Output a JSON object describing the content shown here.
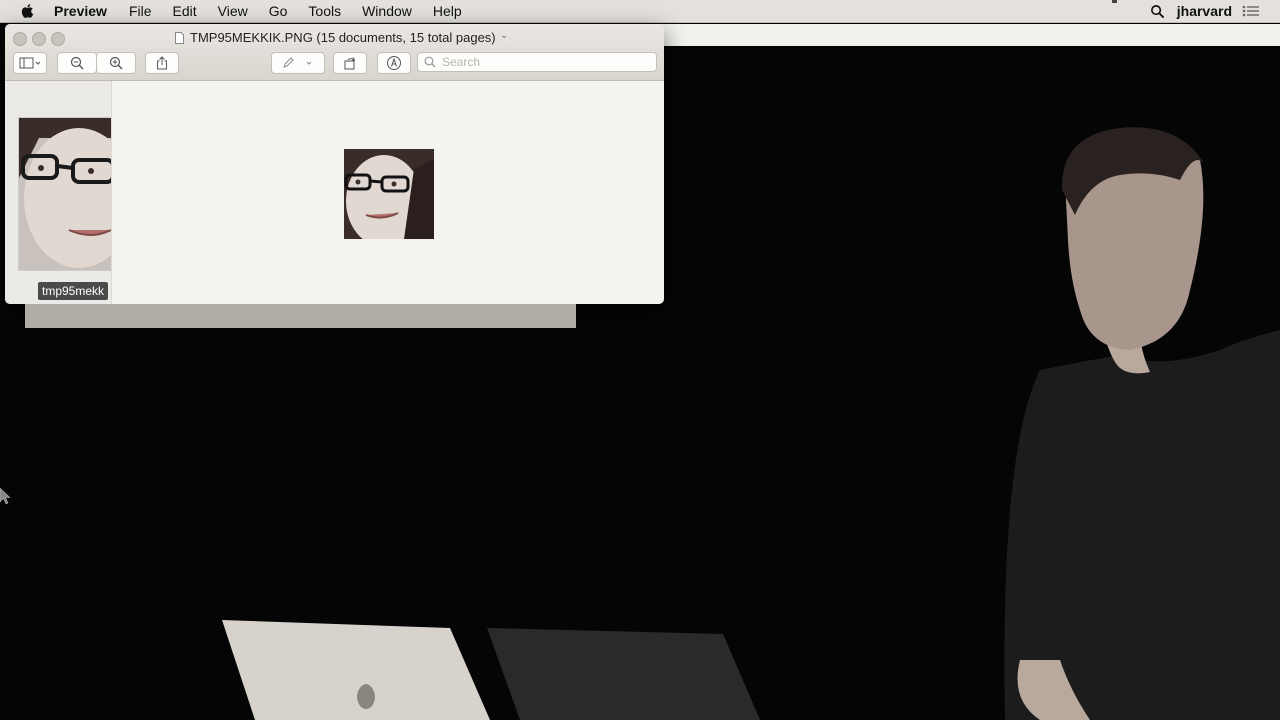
{
  "menubar": {
    "app_name": "Preview",
    "menus": [
      "File",
      "Edit",
      "View",
      "Go",
      "Tools",
      "Window",
      "Help"
    ],
    "user": "jharvard"
  },
  "window": {
    "title": "TMP95MEKKIK.PNG (15 documents, 15 total pages)",
    "search_placeholder": "Search",
    "thumbnail_label": "tmp95mekk",
    "toolbar_icons": [
      "sidebar-icon",
      "zoom-out-icon",
      "zoom-in-icon",
      "share-icon",
      "pen-icon",
      "rotate-icon",
      "markup-icon",
      "search-icon"
    ]
  },
  "colors": {
    "menubar_bg": "#e4e1dc",
    "window_bg": "#f3f3f0",
    "stage_bg": "#050505"
  }
}
